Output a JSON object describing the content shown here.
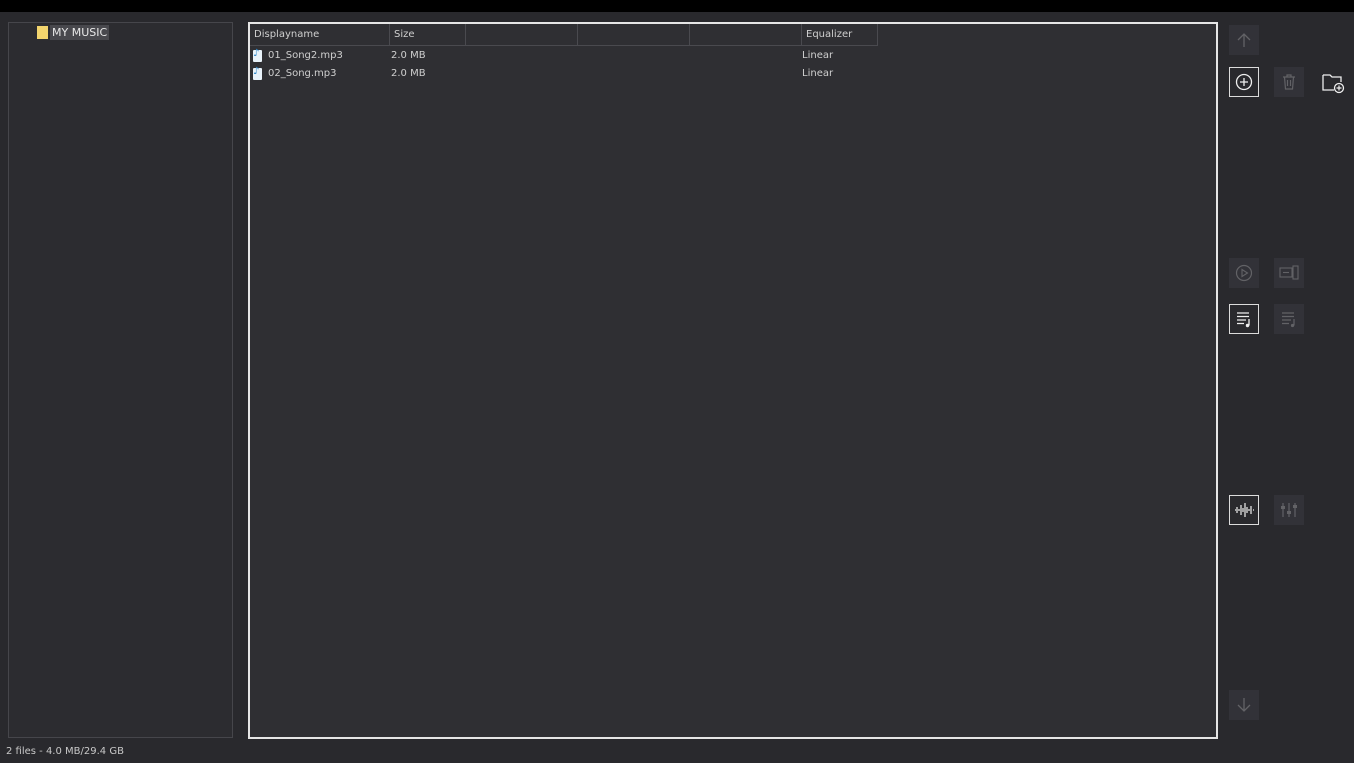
{
  "tree": {
    "root_label": "MY MUSIC"
  },
  "list": {
    "columns": [
      "Displayname",
      "Size",
      "",
      "",
      "",
      "Equalizer"
    ],
    "rows": [
      {
        "name": "01_Song2.mp3",
        "size": "2.0 MB",
        "equalizer": "Linear"
      },
      {
        "name": "02_Song.mp3",
        "size": "2.0 MB",
        "equalizer": "Linear"
      }
    ]
  },
  "toolbar": {
    "icons": {
      "up": "arrow-up-icon",
      "add": "plus-circle-icon",
      "delete": "trash-icon",
      "new_folder": "folder-plus-icon",
      "play": "play-circle-icon",
      "transfer": "device-transfer-icon",
      "playlist": "playlist-icon",
      "playlist_alt": "playlist-edit-icon",
      "waveform": "waveform-icon",
      "equalizer": "equalizer-sliders-icon",
      "down": "arrow-down-icon"
    }
  },
  "status": {
    "text": "2 files - 4.0 MB/29.4 GB"
  },
  "colors": {
    "background": "#29292d",
    "panel": "#2f2f33",
    "folder": "#f2d46d",
    "list_border": "#e6e6e6"
  }
}
